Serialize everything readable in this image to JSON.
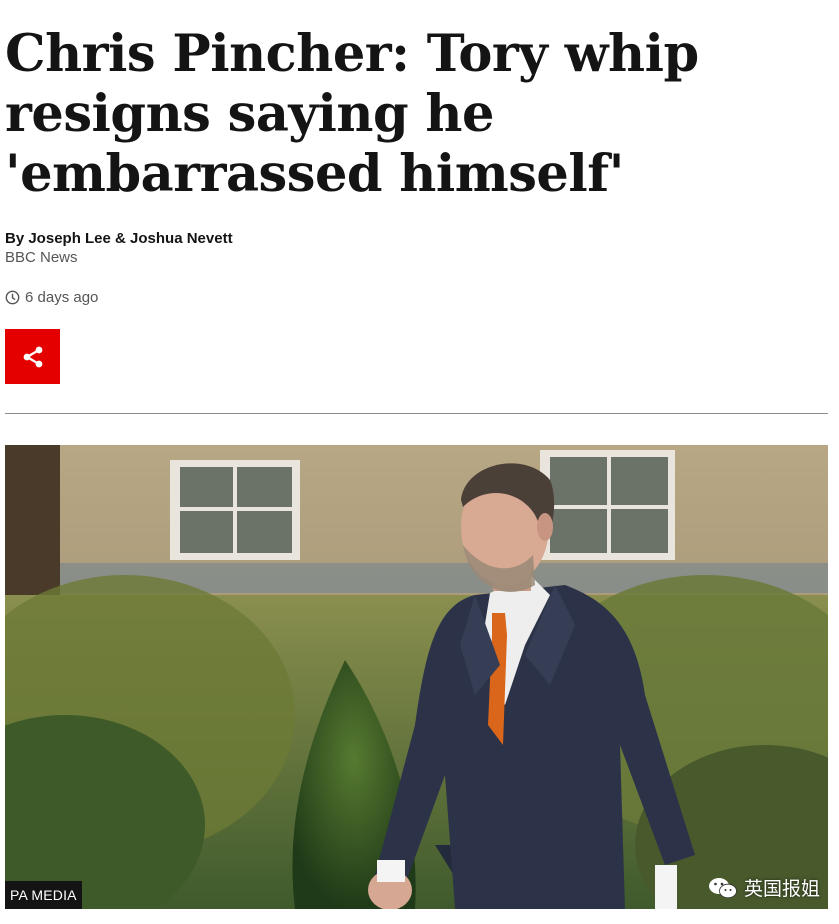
{
  "article": {
    "headline": "Chris Pincher: Tory whip resigns saying he 'embarrassed himself'",
    "byline_authors": "By Joseph Lee & Joshua Nevett",
    "byline_org": "BBC News",
    "timestamp": "6 days ago"
  },
  "share": {
    "icon": "share-icon",
    "color": "#e50000"
  },
  "image": {
    "credit": "PA MEDIA",
    "watermark": "英国报姐",
    "watermark_icon": "wechat-icon"
  },
  "colors": {
    "accent": "#e50000",
    "text": "#141414",
    "muted": "#545658"
  }
}
